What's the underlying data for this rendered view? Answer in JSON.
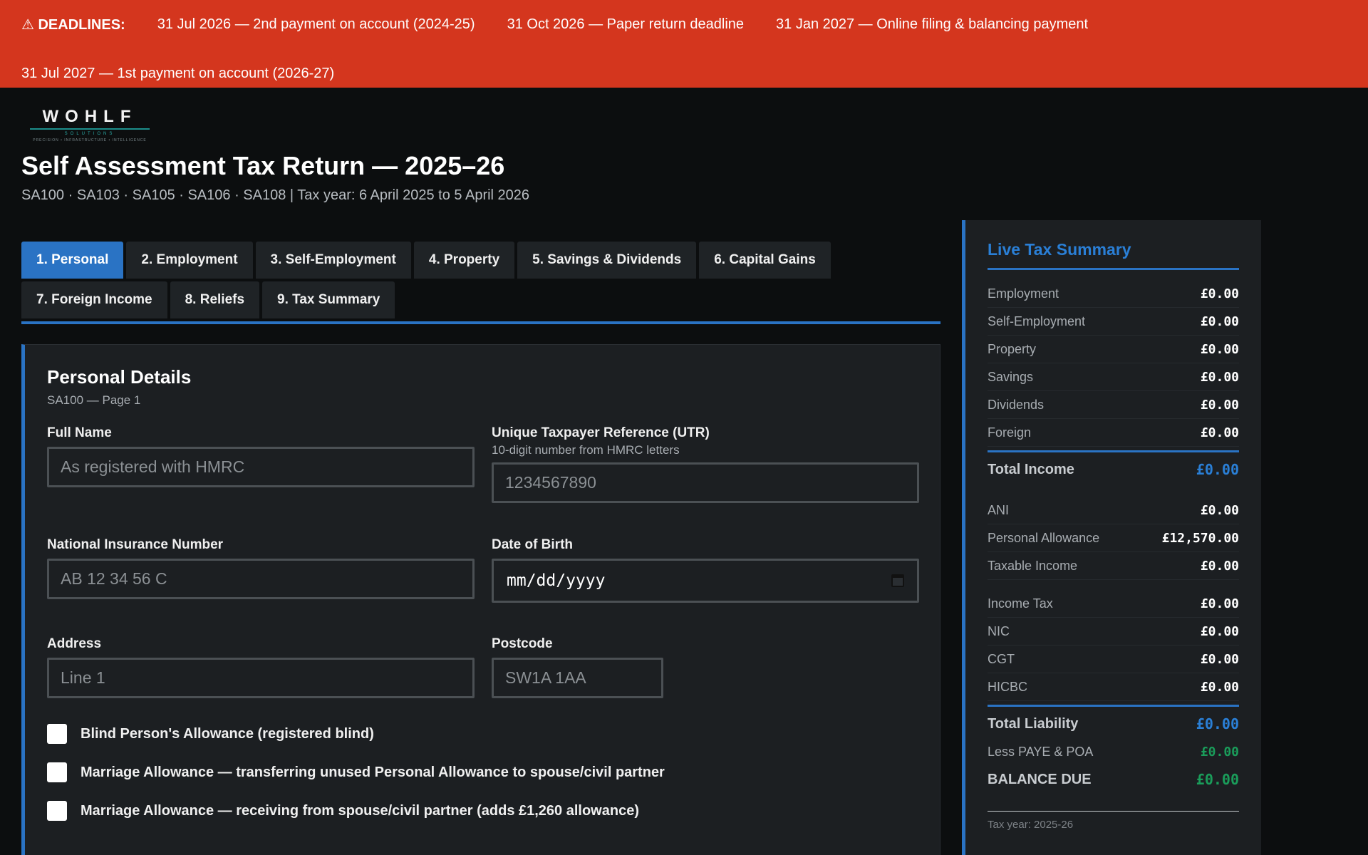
{
  "banner": {
    "title": "⚠ DEADLINES:",
    "items": [
      "31 Jul 2026 — 2nd payment on account (2024-25)",
      "31 Oct 2026 — Paper return deadline",
      "31 Jan 2027 — Online filing & balancing payment",
      "31 Jul 2027 — 1st payment on account (2026-27)"
    ]
  },
  "logo": {
    "name": "WOHLF",
    "sub": "SOLUTIONS",
    "tagline": "PRECISION • INFRASTRUCTURE • INTELLIGENCE"
  },
  "page": {
    "title": "Self Assessment Tax Return — 2025–26",
    "subtitle": "SA100 · SA103 · SA105 · SA106 · SA108 | Tax year: 6 April 2025 to 5 April 2026"
  },
  "tabs": [
    {
      "label": "1. Personal",
      "active": true
    },
    {
      "label": "2. Employment"
    },
    {
      "label": "3. Self-Employment"
    },
    {
      "label": "4. Property"
    },
    {
      "label": "5. Savings & Dividends"
    },
    {
      "label": "6. Capital Gains"
    },
    {
      "label": "7. Foreign Income"
    },
    {
      "label": "8. Reliefs"
    },
    {
      "label": "9. Tax Summary"
    }
  ],
  "form": {
    "title": "Personal Details",
    "subtitle": "SA100 — Page 1",
    "full_name": {
      "label": "Full Name",
      "placeholder": "As registered with HMRC",
      "value": ""
    },
    "utr": {
      "label": "Unique Taxpayer Reference (UTR)",
      "hint": "10-digit number from HMRC letters",
      "placeholder": "1234567890",
      "value": ""
    },
    "nino": {
      "label": "National Insurance Number",
      "placeholder": "AB 12 34 56 C",
      "value": ""
    },
    "dob": {
      "label": "Date of Birth",
      "value": "mm/dd/yyyy"
    },
    "address": {
      "label": "Address",
      "placeholder": "Line 1",
      "value": ""
    },
    "postcode": {
      "label": "Postcode",
      "placeholder": "SW1A 1AA",
      "value": ""
    },
    "checks": [
      {
        "label": "Blind Person's Allowance (registered blind)",
        "checked": false
      },
      {
        "label": "Marriage Allowance — transferring unused Personal Allowance to spouse/civil partner",
        "checked": false
      },
      {
        "label": "Marriage Allowance — receiving from spouse/civil partner (adds £1,260 allowance)",
        "checked": false
      }
    ]
  },
  "summary": {
    "title": "Live Tax Summary",
    "income_rows": [
      {
        "label": "Employment",
        "value": "£0.00"
      },
      {
        "label": "Self-Employment",
        "value": "£0.00"
      },
      {
        "label": "Property",
        "value": "£0.00"
      },
      {
        "label": "Savings",
        "value": "£0.00"
      },
      {
        "label": "Dividends",
        "value": "£0.00"
      },
      {
        "label": "Foreign",
        "value": "£0.00"
      }
    ],
    "total_income": {
      "label": "Total Income",
      "value": "£0.00"
    },
    "allowance_rows": [
      {
        "label": "ANI",
        "value": "£0.00"
      },
      {
        "label": "Personal Allowance",
        "value": "£12,570.00"
      },
      {
        "label": "Taxable Income",
        "value": "£0.00"
      }
    ],
    "tax_rows": [
      {
        "label": "Income Tax",
        "value": "£0.00"
      },
      {
        "label": "NIC",
        "value": "£0.00"
      },
      {
        "label": "CGT",
        "value": "£0.00"
      },
      {
        "label": "HICBC",
        "value": "£0.00"
      }
    ],
    "total_liability": {
      "label": "Total Liability",
      "value": "£0.00"
    },
    "less_paye": {
      "label": "Less PAYE & POA",
      "value": "£0.00"
    },
    "balance_due": {
      "label": "BALANCE DUE",
      "value": "£0.00"
    },
    "footer": "Tax year: 2025-26"
  },
  "colors": {
    "banner": "#d4361e",
    "accent": "#2a73c4",
    "green": "#1a9c5a"
  }
}
